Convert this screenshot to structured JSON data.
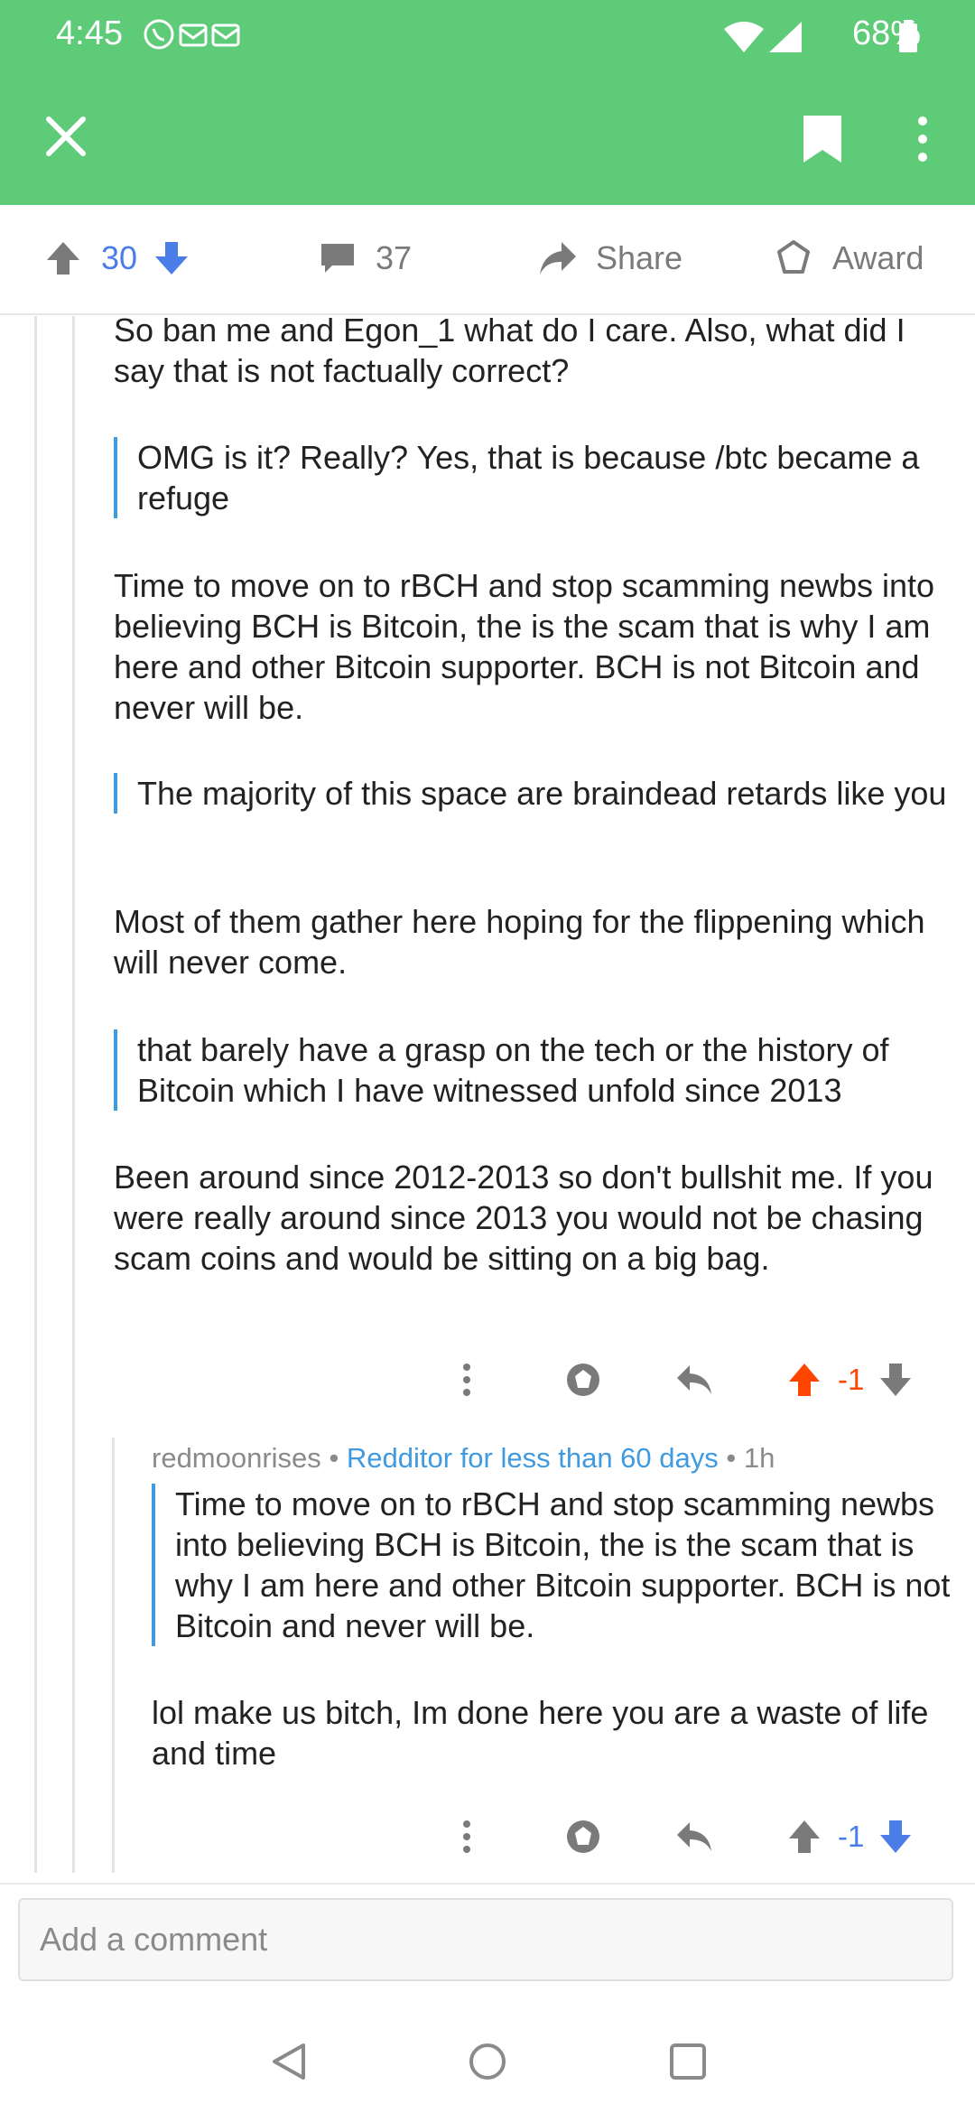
{
  "status_bar": {
    "time": "4:45",
    "battery": "68%"
  },
  "post_actions": {
    "score": "30",
    "comments": "37",
    "share_label": "Share",
    "award_label": "Award"
  },
  "comment1": {
    "p1": "So ban me and Egon_1 what do I care. Also, what did I say that is not factually correct?",
    "q1": "OMG is it? Really? Yes, that is because /btc became a refuge",
    "p2": "Time to move on to rBCH and stop scamming newbs into believing BCH is Bitcoin, the is the scam that is why I am here and other Bitcoin supporter. BCH is not Bitcoin and never will be.",
    "q2": "The majority of this space are braindead retards like you",
    "p3": "Most of them gather here hoping for the flippening which will never come.",
    "q3": "that barely have a grasp on the tech or the history of Bitcoin which I have witnessed unfold since 2013",
    "p4": "Been around since 2012-2013 so don't bullshit me. If you were really around since 2013 you would not be chasing scam coins and would be sitting on a big bag.",
    "score": "-1",
    "vote_color": "#ff4500"
  },
  "comment2": {
    "author": "redmoonrises",
    "flair": "Redditor for less than 60 days",
    "age": "1h",
    "quote": "Time to move on to rBCH and stop scamming newbs into believing BCH is Bitcoin, the is the scam that is why I am here and other Bitcoin supporter. BCH is not Bitcoin and never will be.",
    "body": "lol make us bitch, Im done here you are a waste of life and time",
    "score": "-1",
    "vote_color": "#4a7de8"
  },
  "comment_input": {
    "placeholder": "Add a comment"
  },
  "colors": {
    "app_bar": "#5ecb78",
    "quote_bar": "#3f9ae0",
    "downvote": "#4a7de8",
    "upvote_active": "#ff4500"
  }
}
